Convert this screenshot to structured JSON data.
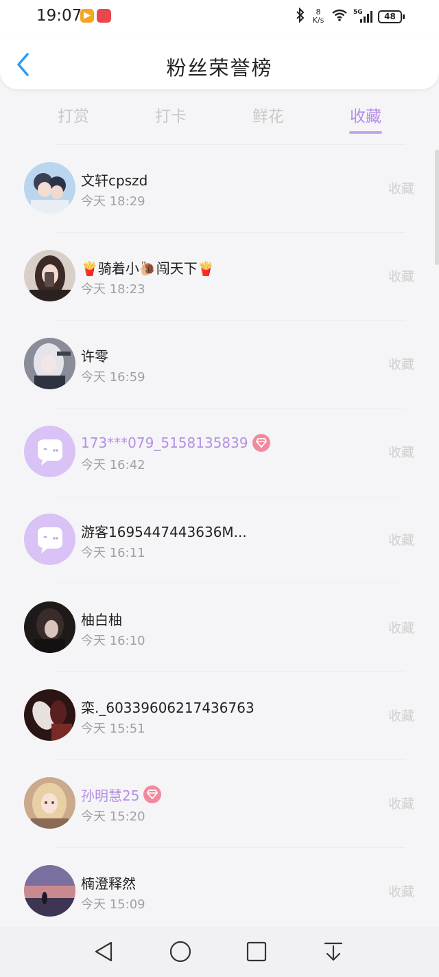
{
  "status": {
    "time": "19:07",
    "speed_value": "8",
    "speed_unit": "K/s",
    "network": "5G",
    "battery": "48"
  },
  "header": {
    "title": "粉丝荣誉榜"
  },
  "tabs": [
    {
      "label": "打赏",
      "active": false
    },
    {
      "label": "打卡",
      "active": false
    },
    {
      "label": "鲜花",
      "active": false
    },
    {
      "label": "收藏",
      "active": true
    }
  ],
  "colors": {
    "accent": "#b48fe3",
    "badge": "#f08a9c",
    "default_avatar_bg": "#d9c2f5"
  },
  "fans": [
    {
      "name": "文轩cpszd",
      "time": "今天 18:29",
      "action": "收藏",
      "highlight": false,
      "badge": false,
      "avatar": "photo-couple"
    },
    {
      "name": "🍟骑着小🐌闯天下🍟",
      "time": "今天 18:23",
      "action": "收藏",
      "highlight": false,
      "badge": false,
      "avatar": "photo-girl-phone"
    },
    {
      "name": "许零",
      "time": "今天 16:59",
      "action": "收藏",
      "highlight": false,
      "badge": false,
      "avatar": "photo-anime-girl"
    },
    {
      "name": "173***079_5158135839",
      "time": "今天 16:42",
      "action": "收藏",
      "highlight": true,
      "badge": true,
      "avatar": "default-chat"
    },
    {
      "name": "游客1695447443636M...",
      "time": "今天 16:11",
      "action": "收藏",
      "highlight": false,
      "badge": false,
      "avatar": "default-chat"
    },
    {
      "name": "柚白柚",
      "time": "今天 16:10",
      "action": "收藏",
      "highlight": false,
      "badge": false,
      "avatar": "photo-dark-portrait"
    },
    {
      "name": "栾._60339606217436763",
      "time": "今天 15:51",
      "action": "收藏",
      "highlight": false,
      "badge": false,
      "avatar": "photo-dark-red"
    },
    {
      "name": "孙明慧25",
      "time": "今天 15:20",
      "action": "收藏",
      "highlight": true,
      "badge": true,
      "avatar": "photo-anime-blonde"
    },
    {
      "name": "楠澄释然",
      "time": "今天 15:09",
      "action": "收藏",
      "highlight": false,
      "badge": false,
      "avatar": "photo-sunset"
    }
  ]
}
